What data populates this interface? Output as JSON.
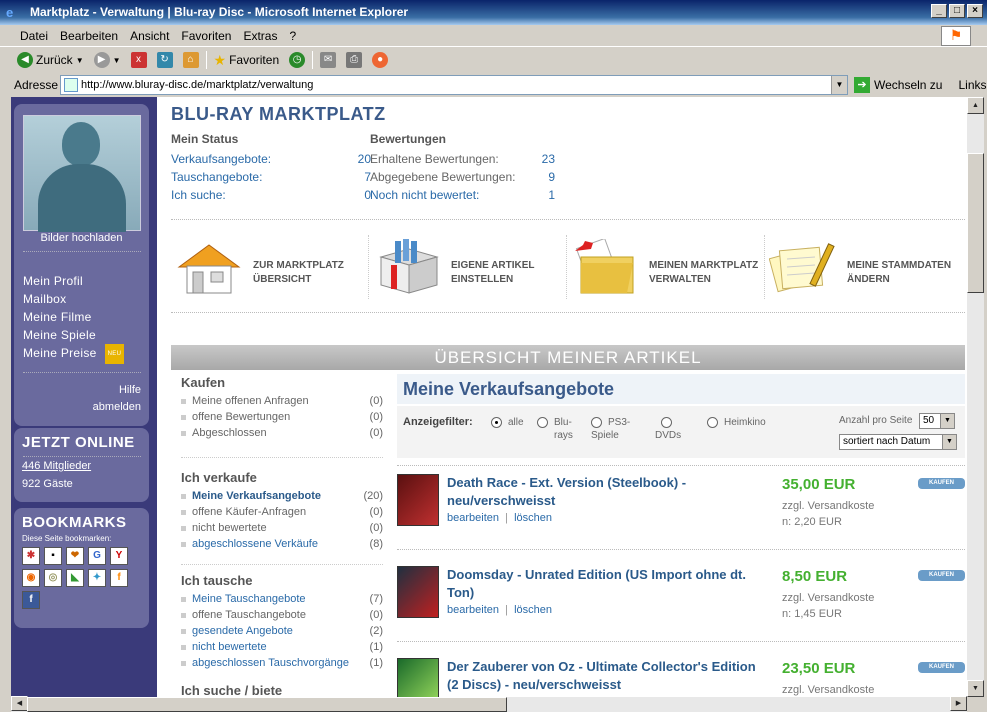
{
  "window": {
    "title": "Marktplatz - Verwaltung | Blu-ray Disc - Microsoft Internet Explorer"
  },
  "menu": [
    "Datei",
    "Bearbeiten",
    "Ansicht",
    "Favoriten",
    "Extras",
    "?"
  ],
  "toolbar": {
    "back": "Zurück",
    "favorites": "Favoriten"
  },
  "address": {
    "label": "Adresse",
    "url": "http://www.bluray-disc.de/marktplatz/verwaltung",
    "go": "Wechseln zu",
    "links": "Links"
  },
  "sidebar": {
    "upload": "Bilder hochladen",
    "nav": [
      "Mein Profil",
      "Mailbox",
      "Meine Filme",
      "Meine Spiele",
      "Meine Preise"
    ],
    "neu": "NEU",
    "help": "Hilfe",
    "logout": "abmelden",
    "online_title": "JETZT ONLINE",
    "members": "446 Mitglieder",
    "guests": "922 Gäste",
    "bookmarks_title": "BOOKMARKS",
    "bookmarks_sub": "Diese Seite bookmarken:"
  },
  "page": {
    "title": "BLU-RAY MARKTPLATZ"
  },
  "status": {
    "title": "Mein Status",
    "rows": [
      {
        "k": "Verkaufsangebote:",
        "v": "20"
      },
      {
        "k": "Tauschangebote:",
        "v": "7"
      },
      {
        "k": "Ich suche:",
        "v": "0"
      }
    ]
  },
  "ratings": {
    "title": "Bewertungen",
    "rows": [
      {
        "k": "Erhaltene Bewertungen:",
        "v": "23"
      },
      {
        "k": "Abgegebene Bewertungen:",
        "v": "9"
      },
      {
        "k": "Noch nicht bewertet:",
        "v": "1"
      }
    ]
  },
  "actions": [
    {
      "l1": "ZUR MARKTPLATZ",
      "l2": "ÜBERSICHT"
    },
    {
      "l1": "EIGENE ARTIKEL",
      "l2": "EINSTELLEN"
    },
    {
      "l1": "MEINEN MARKTPLATZ",
      "l2": "VERWALTEN"
    },
    {
      "l1": "MEINE STAMMDATEN",
      "l2": "ÄNDERN"
    }
  ],
  "overview_title": "ÜBERSICHT MEINER ARTIKEL",
  "left": {
    "kaufen": {
      "title": "Kaufen",
      "items": [
        {
          "t": "Meine offenen Anfragen",
          "c": "(0)"
        },
        {
          "t": "offene Bewertungen",
          "c": "(0)"
        },
        {
          "t": "Abgeschlossen",
          "c": "(0)"
        }
      ]
    },
    "verkaufe": {
      "title": "Ich verkaufe",
      "items": [
        {
          "t": "Meine Verkaufsangebote",
          "c": "(20)"
        },
        {
          "t": "offene Käufer-Anfragen",
          "c": "(0)"
        },
        {
          "t": "nicht bewertete",
          "c": "(0)"
        },
        {
          "t": "abgeschlossene Verkäufe",
          "c": "(8)"
        }
      ]
    },
    "tausche": {
      "title": "Ich tausche",
      "items": [
        {
          "t": "Meine Tauschangebote",
          "c": "(7)"
        },
        {
          "t": "offene Tauschangebote",
          "c": "(0)"
        },
        {
          "t": "gesendete Angebote",
          "c": "(2)"
        },
        {
          "t": "nicht bewertete",
          "c": "(1)"
        },
        {
          "t": "abgeschlossen Tauschvorgänge",
          "c": "(1)"
        }
      ]
    },
    "suche_partial": "Ich suche / biete"
  },
  "offers": {
    "title": "Meine Verkaufsangebote",
    "filter_label": "Anzeigefilter:",
    "filters": [
      {
        "l1": "alle",
        "l2": ""
      },
      {
        "l1": "Blu-",
        "l2": "rays"
      },
      {
        "l1": "PS3-",
        "l2": "Spiele"
      },
      {
        "l1": "",
        "l2": "DVDs"
      },
      {
        "l1": "Heimkino",
        "l2": ""
      }
    ],
    "per_page_label": "Anzahl pro Seite",
    "per_page": "50",
    "sort": "sortiert nach Datum",
    "items": [
      {
        "title": "Death Race - Ext. Version (Steelbook) - neu/verschweisst",
        "price": "35,00 EUR",
        "ship1": "zzgl. Versandkoste",
        "ship2": "n: 2,20 EUR"
      },
      {
        "title": "Doomsday - Unrated Edition (US Import ohne dt. Ton)",
        "price": "8,50 EUR",
        "ship1": "zzgl. Versandkoste",
        "ship2": "n: 1,45 EUR"
      },
      {
        "title": "Der Zauberer von Oz - Ultimate Collector's Edition (2 Discs) - neu/verschweisst",
        "price": "23,50 EUR",
        "ship1": "zzgl. Versandkoste",
        "ship2": ""
      }
    ],
    "edit": "bearbeiten",
    "delete": "löschen",
    "sep": "|",
    "buy": "KAUFEN"
  }
}
